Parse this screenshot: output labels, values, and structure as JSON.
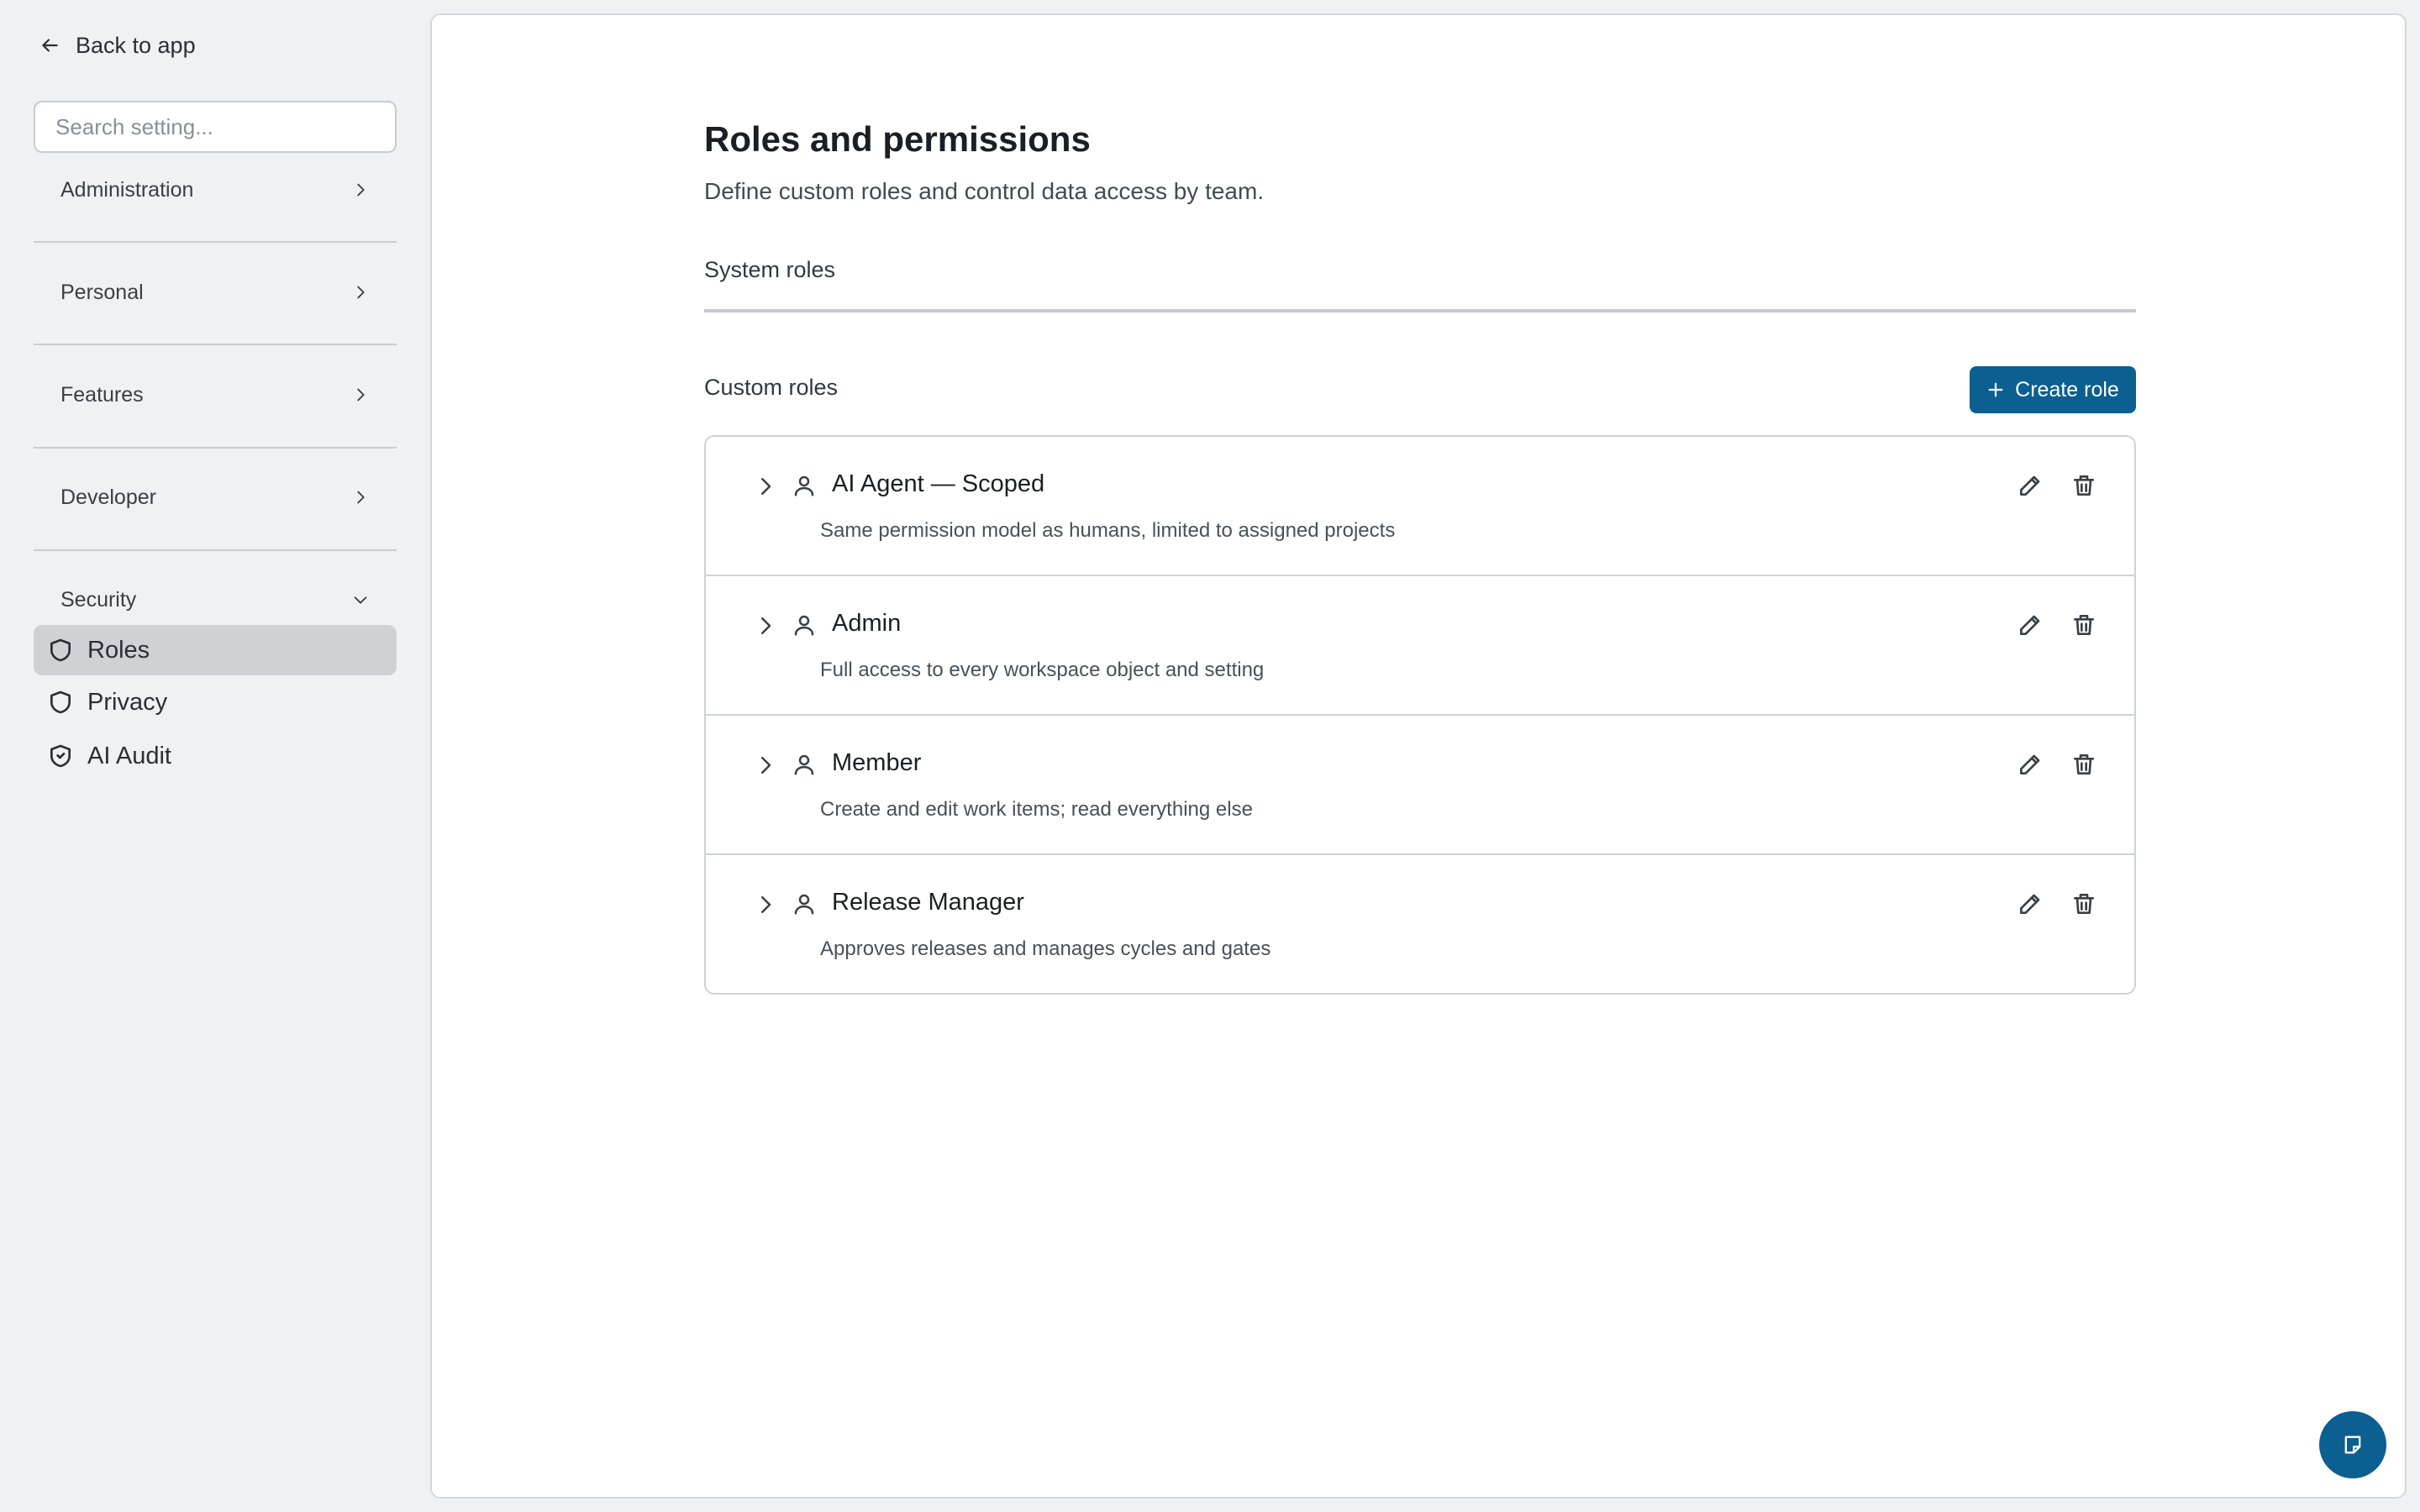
{
  "sidebar": {
    "back_label": "Back to app",
    "search_placeholder": "Search setting...",
    "sections": [
      {
        "label": "Administration"
      },
      {
        "label": "Personal"
      },
      {
        "label": "Features"
      },
      {
        "label": "Developer"
      },
      {
        "label": "Security"
      }
    ],
    "security_items": [
      {
        "label": "Roles",
        "active": true
      },
      {
        "label": "Privacy"
      },
      {
        "label": "AI Audit"
      }
    ]
  },
  "main": {
    "title": "Roles and permissions",
    "subtitle": "Define custom roles and control data access by team.",
    "system_roles_label": "System roles",
    "custom_roles_label": "Custom roles",
    "create_role_label": "Create role",
    "roles": [
      {
        "name": "AI Agent — Scoped",
        "description": "Same permission model as humans, limited to assigned projects"
      },
      {
        "name": "Admin",
        "description": "Full access to every workspace object and setting"
      },
      {
        "name": "Member",
        "description": "Create and edit work items; read everything else"
      },
      {
        "name": "Release Manager",
        "description": "Approves releases and manages cycles and gates"
      }
    ]
  },
  "colors": {
    "accent": "#0b5f91",
    "active_nav": "#cfd1d4",
    "background": "#f0f1f3"
  },
  "icons": {
    "back": "arrow-left-icon",
    "section": "chevron-right-icon",
    "section_open": "chevron-down-icon",
    "nav": "shield-icon",
    "role": "person-icon",
    "edit": "pencil-icon",
    "delete": "trash-icon",
    "fab": "note-icon"
  }
}
